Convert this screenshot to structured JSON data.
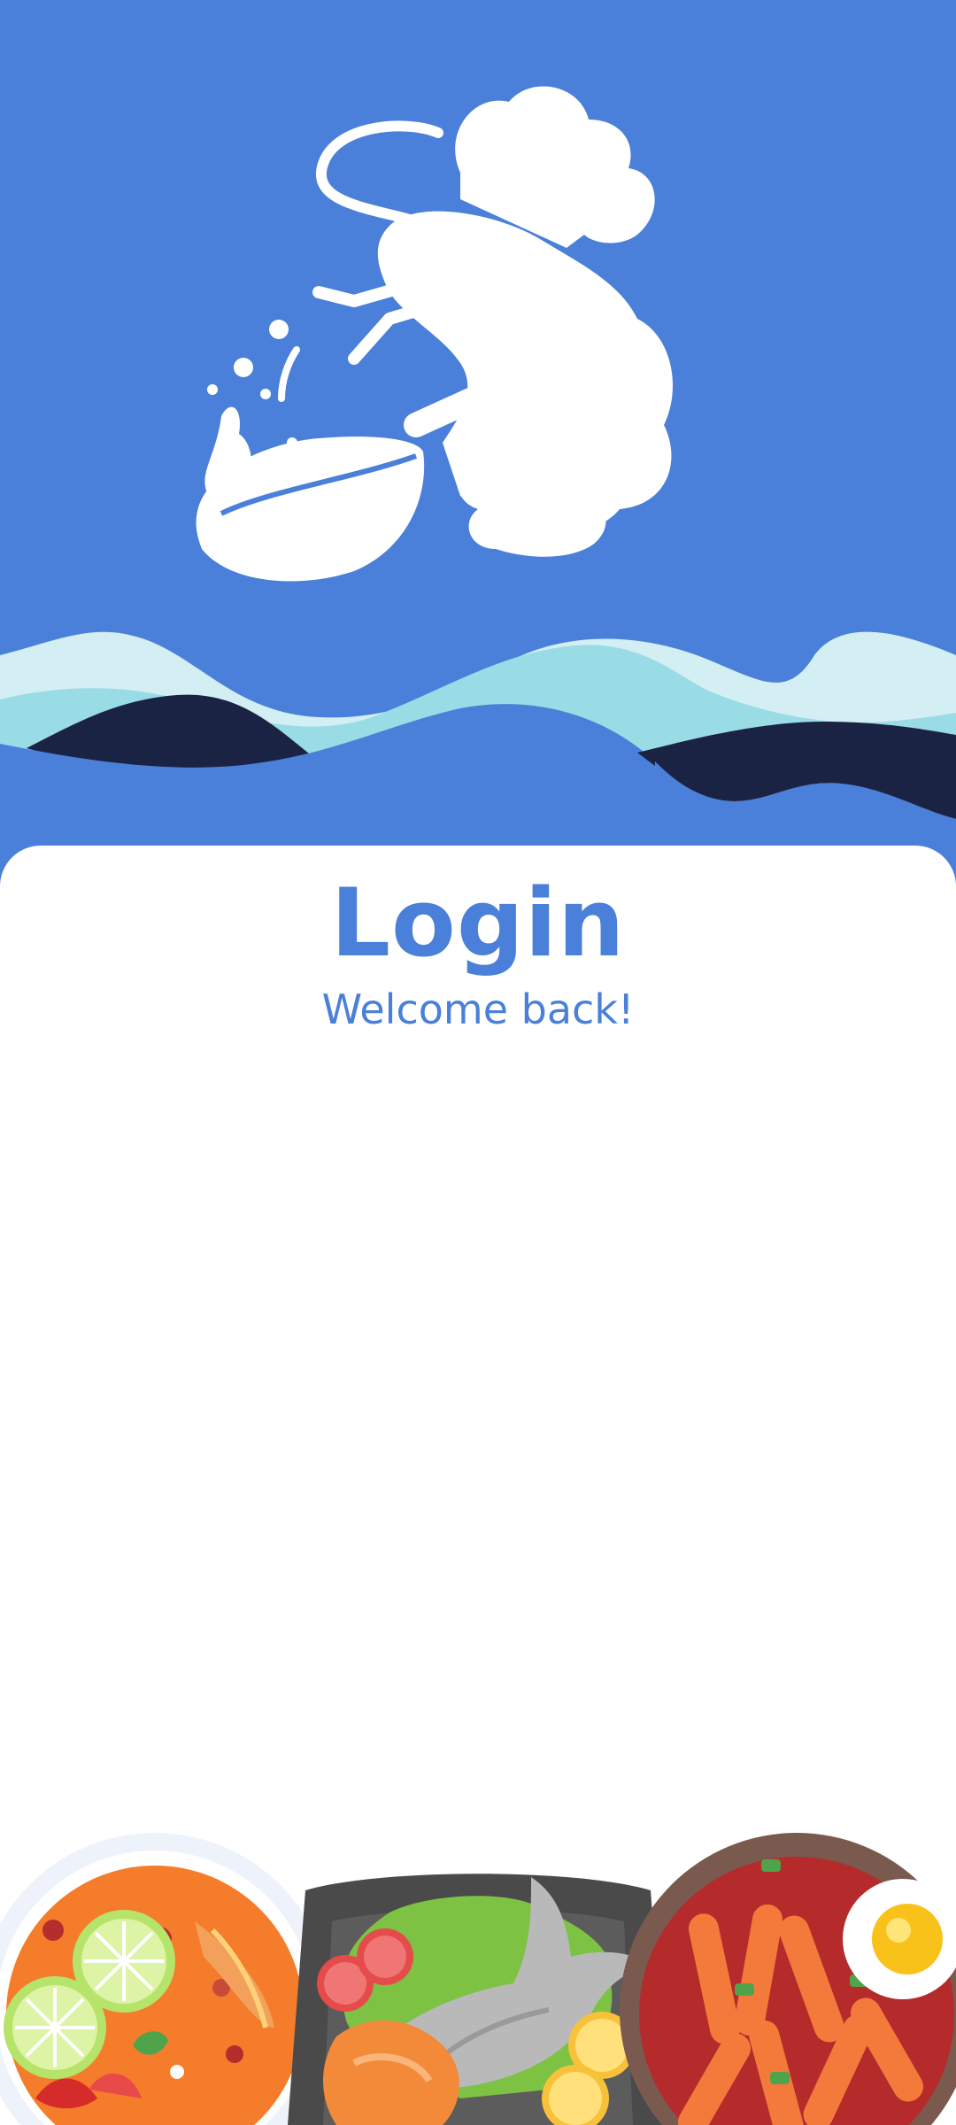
{
  "header": {
    "logo_icon": "lobster-chef-wok-icon",
    "decoration": "wave-illustration"
  },
  "login": {
    "title": "Login",
    "subtitle": "Welcome back!"
  },
  "footer": {
    "illustration": "food-dishes-illustration",
    "dishes": [
      "tom-yum-soup-icon",
      "grilled-fish-plate-icon",
      "tteokbokki-bowl-icon"
    ]
  },
  "colors": {
    "primary": "#4A80D9",
    "wave_light": "#D4EFF3",
    "wave_mid": "#9ADCE6",
    "wave_dark": "#1B2344",
    "card": "#FFFFFF"
  }
}
